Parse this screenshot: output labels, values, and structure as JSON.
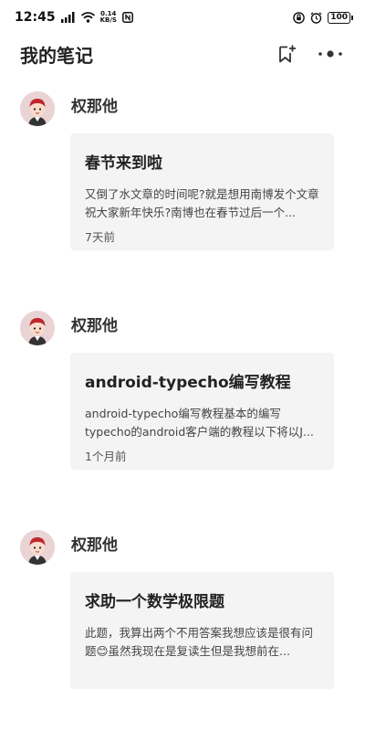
{
  "status_bar": {
    "time": "12:45",
    "net_speed": "0.14",
    "net_unit": "KB/S",
    "battery": "100"
  },
  "app_bar": {
    "title": "我的笔记",
    "icons": [
      "bookmark-add-icon",
      "more-options-icon"
    ]
  },
  "posts": [
    {
      "author": "权那他",
      "title": "春节来到啦",
      "excerpt": "又倒了水文章的时间呢?就是想用南博发个文章祝大家新年快乐?南博也在春节过后一个...",
      "time": "7天前"
    },
    {
      "author": "权那他",
      "title": "android-typecho编写教程",
      "excerpt": "android-typecho编写教程基本的编写typecho的android客户端的教程以下将以J...",
      "time": "1个月前"
    },
    {
      "author": "权那他",
      "title": "求助一个数学极限题",
      "excerpt": "此题，我算出两个不用答案我想应该是很有问题😊虽然我现在是复读生但是我想前在...",
      "time": ""
    }
  ]
}
